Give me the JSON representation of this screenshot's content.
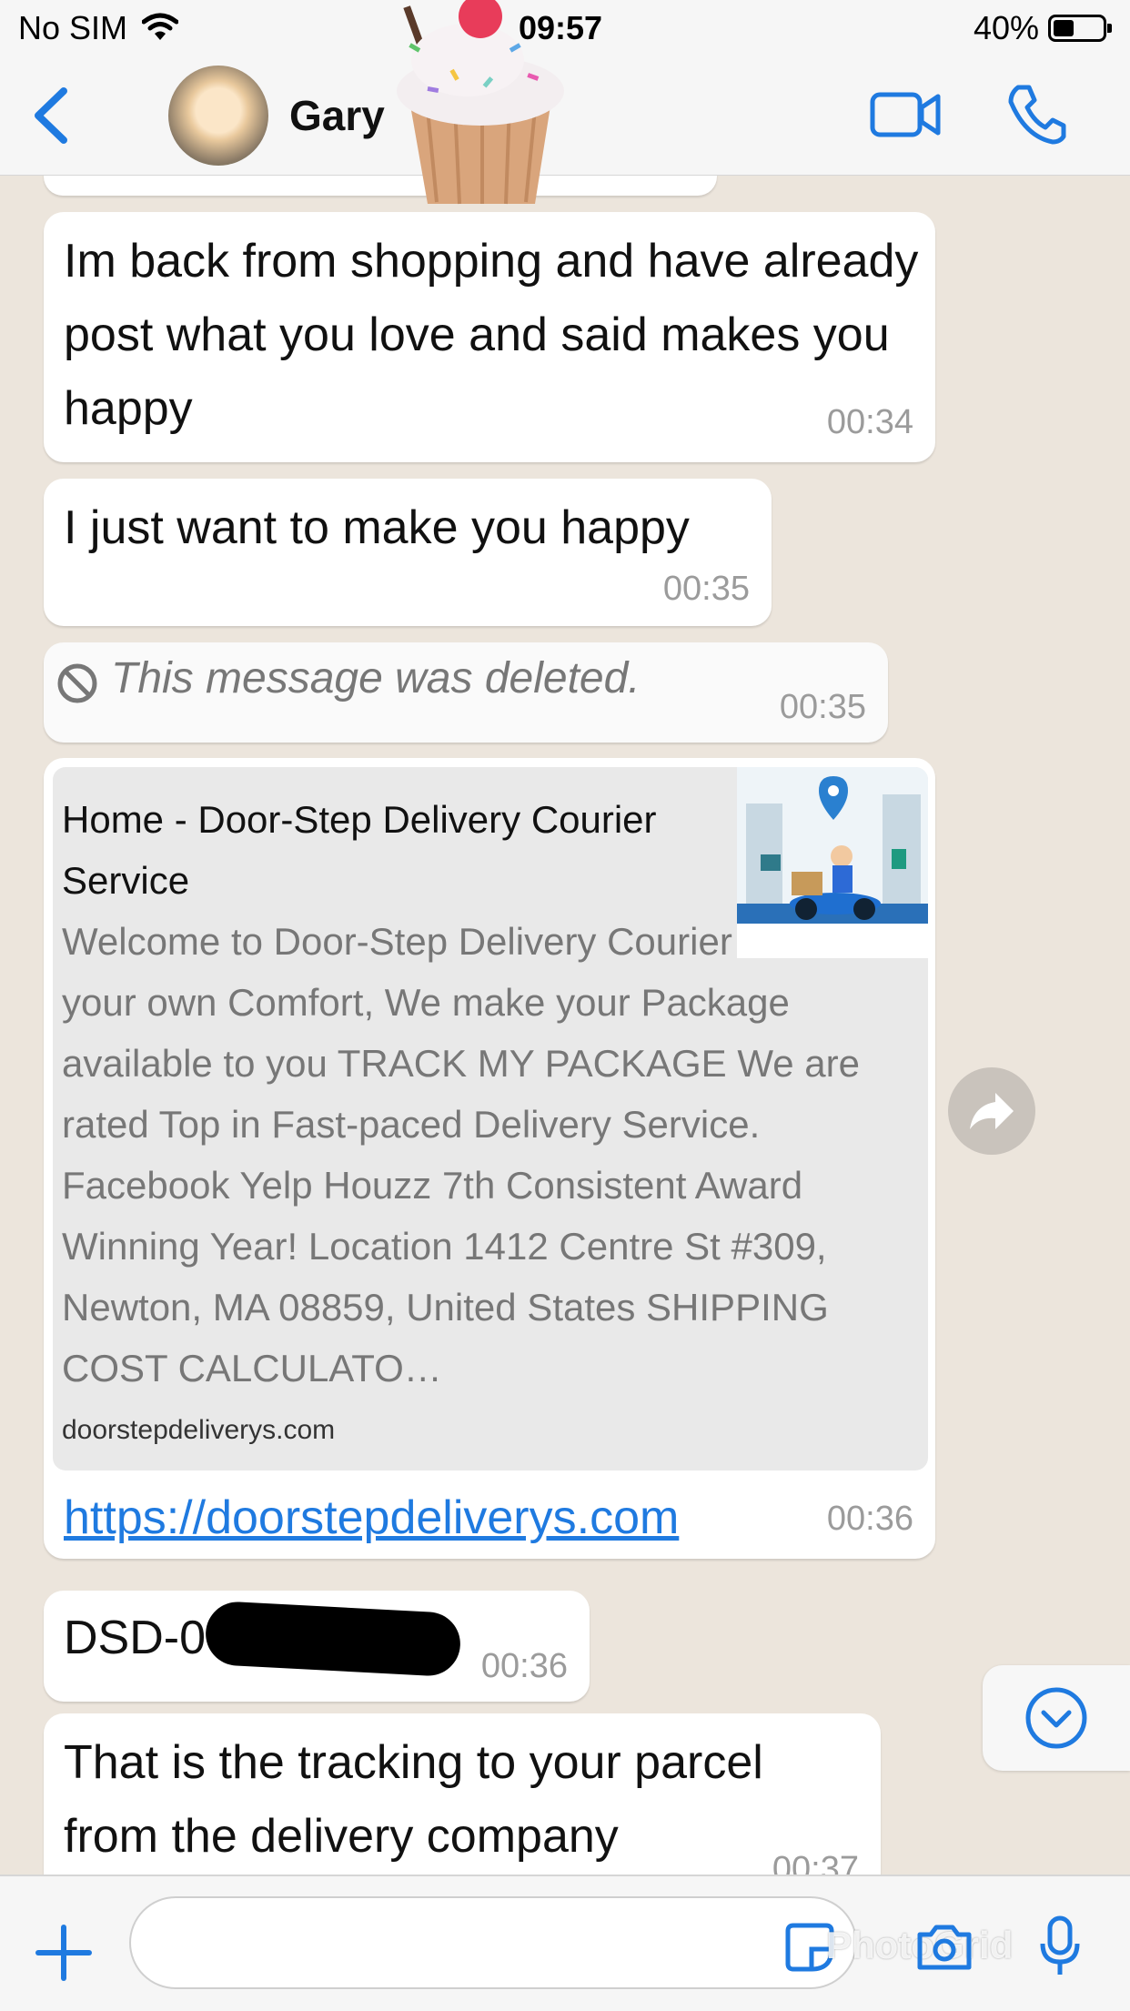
{
  "status_bar": {
    "carrier": "No SIM",
    "time": "09:57",
    "battery": "40%"
  },
  "header": {
    "contact_name": "Gary",
    "icons": [
      "back-chevron-icon",
      "video-call-icon",
      "phone-icon"
    ]
  },
  "messages": [
    {
      "text": "Im back from shopping and have already post what you love and said makes you happy",
      "time": "00:34"
    },
    {
      "text": "I just want to make you happy",
      "time": "00:35"
    },
    {
      "text": "This message was deleted.",
      "time": "00:35",
      "deleted": true
    },
    {
      "link_preview": {
        "title": "Home - Door-Step Delivery Courier Service",
        "description": "Welcome to Door-Step Delivery Courier Service At your own Comfort, We make your Package available to you TRACK MY PACKAGE We are rated Top in Fast-paced Delivery Service. Facebook Yelp Houzz 7th Consistent Award Winning Year! Location 1412 Centre St #309, Newton, MA 08859, United States SHIPPING COST CALCULATO…",
        "domain": "doorstepdeliverys.com"
      },
      "text": "https://doorstepdeliverys.com",
      "time": "00:36"
    },
    {
      "text": "DSD-0",
      "time": "00:36"
    },
    {
      "text": "That is the tracking to your parcel from the delivery company",
      "time": "00:37"
    }
  ],
  "input_bar": {
    "placeholder": "",
    "watermark": "PhotoGrid"
  },
  "colors": {
    "accent": "#1f7ae0",
    "bubble": "#ffffff",
    "background": "#ece5dc",
    "timestamp": "#9b9b9b"
  }
}
